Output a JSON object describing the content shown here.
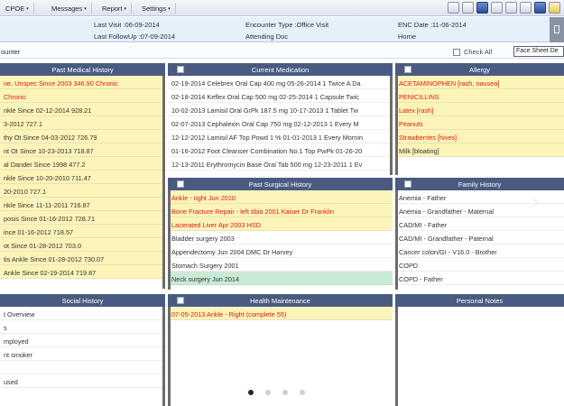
{
  "menu": {
    "items": [
      {
        "label": "CPOE",
        "caret": "▾"
      },
      {
        "label": "Messages",
        "caret": "▾"
      },
      {
        "label": "Report",
        "caret": "▾"
      },
      {
        "label": "Settings",
        "caret": "▾"
      }
    ],
    "toolbar_icons": [
      "eraser-icon",
      "edit-icon",
      "screen-icon",
      "document-icon",
      "user-icon",
      "stethoscope-icon",
      "download-icon",
      "alert-icon"
    ]
  },
  "encounter": {
    "last_visit": "Last Visit :06-09-2014",
    "last_followup": "Last FollowUp :07-09-2014",
    "encounter_type": "Encounter Type :Office Visit",
    "attending": "Attending Doc",
    "enc_date": "ENC Date :11-06-2014",
    "location": "Home",
    "title": "ounter",
    "check_all": "Check All",
    "sheet_select": "Face Sheet De"
  },
  "panels": {
    "past_medical": {
      "title": "Past Medical History",
      "rows": [
        {
          "text": "ne, Unspec Since 2003 346.90 Chronic",
          "style": "red"
        },
        {
          "text": "Chronic",
          "style": "red"
        },
        {
          "text": "nkle Since 02-12-2014 928.21",
          "style": ""
        },
        {
          "text": "3-2012 727.1",
          "style": ""
        },
        {
          "text": "thy Ot Since 04-03-2012 726.79",
          "style": ""
        },
        {
          "text": "nt Ot Since 10-23-2013 718.87",
          "style": ""
        },
        {
          "text": "al Dander Since 1998 477.2",
          "style": ""
        },
        {
          "text": "nkle Since 10-20-2010 711.47",
          "style": ""
        },
        {
          "text": "20-2010 727.1",
          "style": ""
        },
        {
          "text": "nkle Since 11-11-2011 716.87",
          "style": ""
        },
        {
          "text": "posis Since 01-16-2012 728.71",
          "style": ""
        },
        {
          "text": "ince 01-16-2012 718.57",
          "style": ""
        },
        {
          "text": "ot Since 01-28-2012 703.0",
          "style": ""
        },
        {
          "text": "tis Ankle Since 01-28-2012 730.07",
          "style": ""
        },
        {
          "text": "Ankle Since 02-19-2014 719.87",
          "style": ""
        }
      ]
    },
    "current_medication": {
      "title": "Current Medication",
      "rows": [
        {
          "text": "02-19-2014 Celebrex Oral Cap 400 mg 05-26-2014 1 Twice A Da",
          "style": "white"
        },
        {
          "text": "02-18-2014 Keflex Oral Cap 500 mg 02-25-2014 1 Capsule Twic",
          "style": "white"
        },
        {
          "text": "10-02-2013 Lamisil Oral GrPk 187.5 mg 10-17-2013 1 Tablet Tw",
          "style": "white"
        },
        {
          "text": "02-07-2013 Cephalexin Oral Cap 750 mg 02-12-2013 1 Every M",
          "style": "white"
        },
        {
          "text": "12-12-2012 Lamisil AF Top Powd 1 % 01-01-2013 1 Every Mornin",
          "style": "white"
        },
        {
          "text": "01-16-2012 Foot Cleanser Combination No.1 Top PwPk 01-26-20",
          "style": "white"
        },
        {
          "text": "12-13-2011 Erythromycin Base Oral Tab 500 mg 12-23-2011 1 Ev",
          "style": "white"
        }
      ]
    },
    "allergy": {
      "title": "Allergy",
      "rows": [
        {
          "text": "ACETAMINOPHEN [rash, nausea]",
          "style": "red"
        },
        {
          "text": "PENICILLINS",
          "style": "red"
        },
        {
          "text": "Latex [rash]",
          "style": "red"
        },
        {
          "text": "Peanuts",
          "style": "red"
        },
        {
          "text": "Strawberries [hives]",
          "style": "red"
        },
        {
          "text": "Milk [bloating]",
          "style": ""
        }
      ]
    },
    "past_surgical": {
      "title": "Past Surgical History",
      "rows": [
        {
          "text": "Ankle - right Jun 2010",
          "style": "red"
        },
        {
          "text": "Bone Fracture Repair - left tibia 2001 Kaiser Dr Franklin",
          "style": "red"
        },
        {
          "text": "Lacerated Liver Apr 2003 HSD",
          "style": "red"
        },
        {
          "text": "Bladder surgery 2003",
          "style": "white"
        },
        {
          "text": "Appendectomy Jun 2004 DMC Dr Harvey",
          "style": "white"
        },
        {
          "text": "Stomach Surgery 2001",
          "style": "white"
        },
        {
          "text": "Neck surgery Jun 2014",
          "style": "green"
        }
      ]
    },
    "family_history": {
      "title": "Family History",
      "rows": [
        {
          "text": "Anemia - Father",
          "style": "white"
        },
        {
          "text": "Anemia - Grandfather - Maternal",
          "style": "white"
        },
        {
          "text": "CAD/MI - Father",
          "style": "white"
        },
        {
          "text": "CAD/MI - Grandfather - Paternal",
          "style": "white"
        },
        {
          "text": "Cancer colon/GI - V16.0 - Brother",
          "style": "white"
        },
        {
          "text": "COPD",
          "style": "white"
        },
        {
          "text": "COPD - Father",
          "style": "white"
        }
      ]
    },
    "social_history": {
      "title": "Social History",
      "rows": [
        {
          "text": "t Overview"
        },
        {
          "text": "s"
        },
        {
          "text": "mployed"
        },
        {
          "text": "nt smoker"
        },
        {
          "text": ""
        },
        {
          "text": "used"
        }
      ]
    },
    "health_maintenance": {
      "title": "Health Maintenance",
      "rows": [
        {
          "text": "07-05-2013 Ankle - Right (complete 55)",
          "style": "red"
        }
      ]
    },
    "personal_notes": {
      "title": "Personal Notes"
    }
  },
  "pager": {
    "count": 4,
    "active": 1
  }
}
